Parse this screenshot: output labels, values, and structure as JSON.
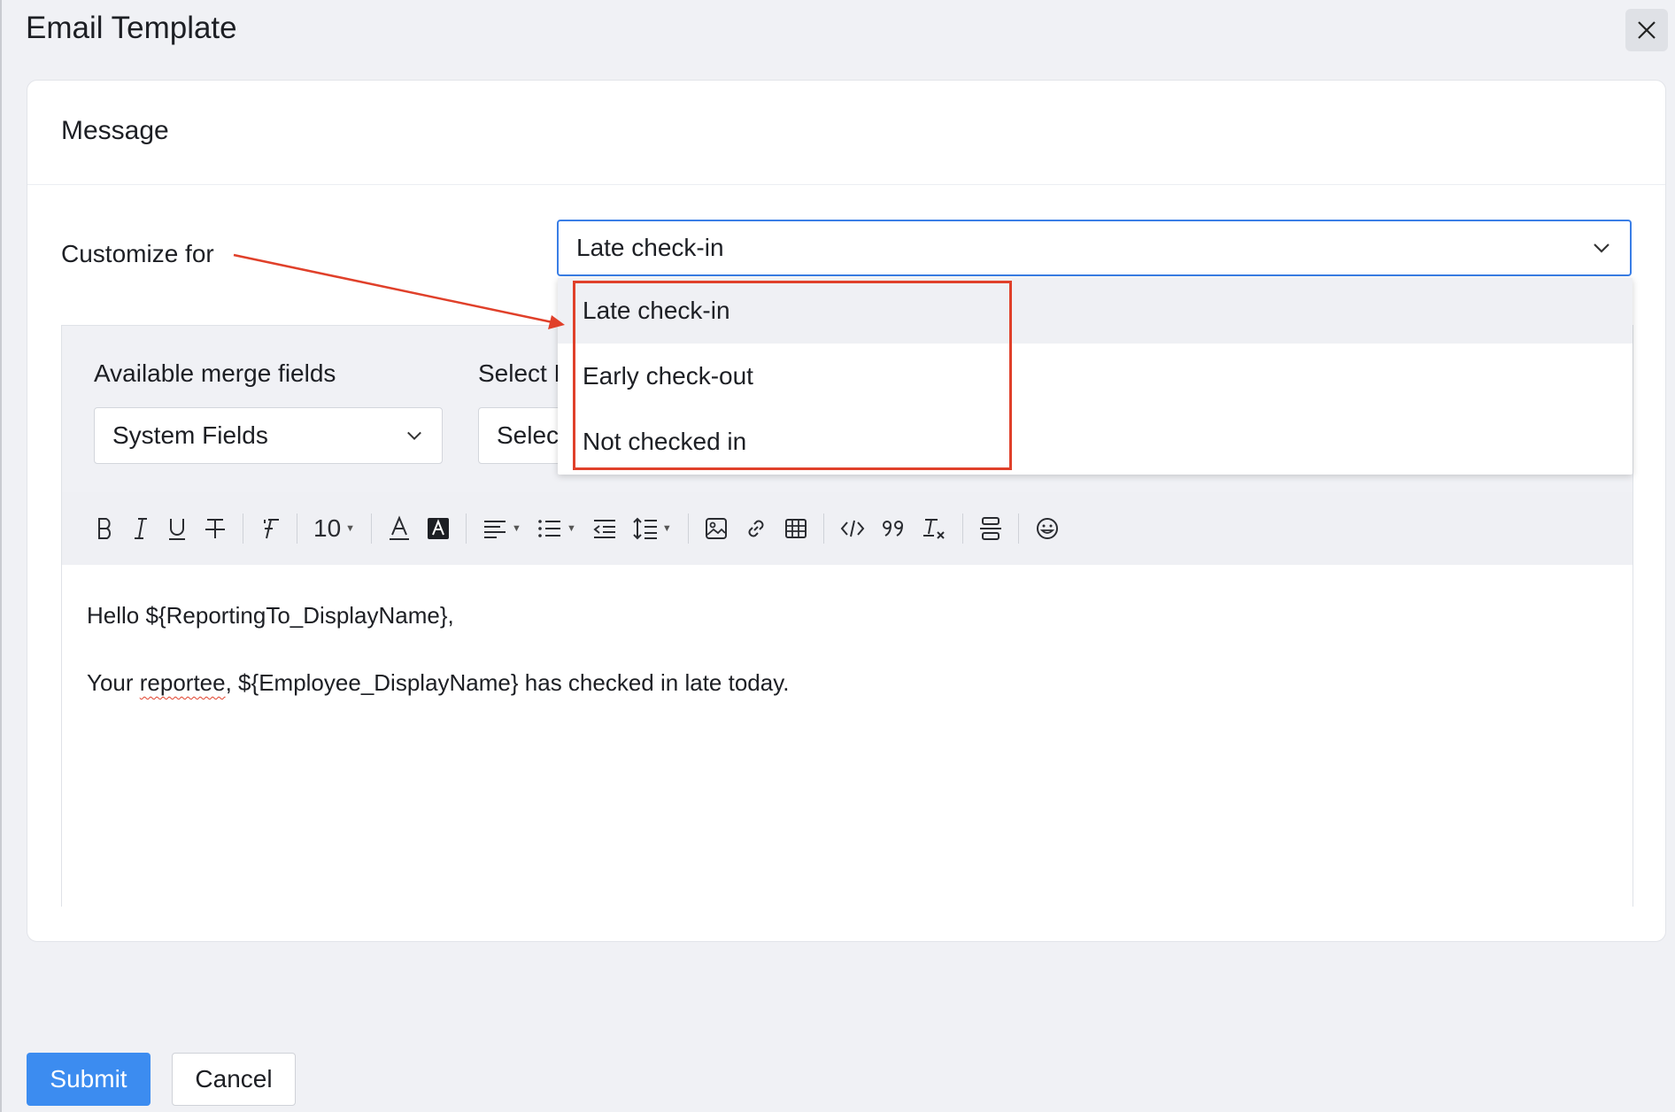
{
  "modal": {
    "title": "Email Template"
  },
  "card": {
    "title": "Message"
  },
  "customize": {
    "label": "Customize for",
    "selected": "Late check-in",
    "options": [
      "Late check-in",
      "Early check-out",
      "Not checked in"
    ]
  },
  "merge": {
    "label": "Available merge fields",
    "selected": "System Fields",
    "second_label": "Select F",
    "second_value": "Select"
  },
  "toolbar": {
    "font_size": "10"
  },
  "editor": {
    "line1": "Hello ${ReportingTo_DisplayName},",
    "line2_a": "Your ",
    "line2_word": "reportee",
    "line2_b": ", ${Employee_DisplayName} has checked in late today."
  },
  "actions": {
    "submit": "Submit",
    "cancel": "Cancel"
  },
  "colors": {
    "accent": "#3c8cf0",
    "annotation": "#e0402a"
  }
}
